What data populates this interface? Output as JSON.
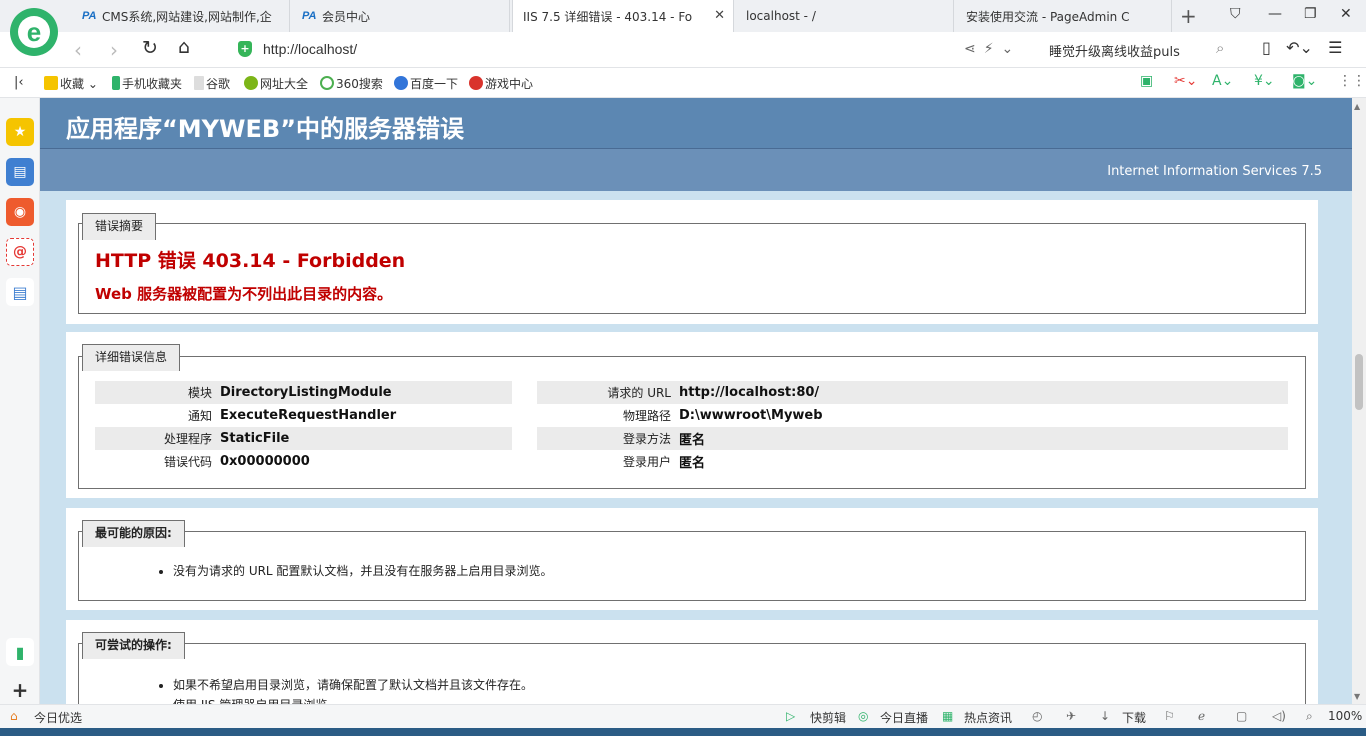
{
  "tabs": [
    {
      "fav": "PA",
      "title": "CMS系统,网站建设,网站制作,企",
      "active": false
    },
    {
      "fav": "PA",
      "title": "会员中心",
      "active": false
    },
    {
      "fav": "page",
      "title": "IIS 7.5 详细错误 - 403.14 - Fo",
      "active": true
    },
    {
      "fav": "page",
      "title": "localhost - /",
      "active": false
    },
    {
      "fav": "page",
      "title": "安装使用交流 - PageAdmin C",
      "active": false
    }
  ],
  "address": {
    "url": "http://localhost/",
    "search_text": "睡觉升级离线收益puls"
  },
  "bookmarks": [
    "收藏",
    "手机收藏夹",
    "谷歌",
    "网址大全",
    "360搜索",
    "百度一下",
    "游戏中心"
  ],
  "page": {
    "header_title": "应用程序“MYWEB”中的服务器错误",
    "server_name": "Internet Information Services 7.5",
    "summary": {
      "legend": "错误摘要",
      "error_title": "HTTP 错误 403.14 - Forbidden",
      "error_message": "Web 服务器被配置为不列出此目录的内容。"
    },
    "details": {
      "legend": "详细错误信息",
      "left": [
        {
          "k": "模块",
          "v": "DirectoryListingModule"
        },
        {
          "k": "通知",
          "v": "ExecuteRequestHandler"
        },
        {
          "k": "处理程序",
          "v": "StaticFile"
        },
        {
          "k": "错误代码",
          "v": "0x00000000"
        }
      ],
      "right": [
        {
          "k": "请求的 URL",
          "v": "http://localhost:80/"
        },
        {
          "k": "物理路径",
          "v": "D:\\wwwroot\\Myweb"
        },
        {
          "k": "登录方法",
          "v": "匿名"
        },
        {
          "k": "登录用户",
          "v": "匿名"
        }
      ]
    },
    "causes": {
      "legend": "最可能的原因:",
      "items": [
        "没有为请求的 URL 配置默认文档，并且没有在服务器上启用目录浏览。"
      ]
    },
    "actions": {
      "legend": "可尝试的操作:",
      "items": [
        "如果不希望启用目录浏览，请确保配置了默认文档并且该文件存在。",
        "使用 IIS 管理器启用目录浏览。"
      ]
    }
  },
  "status": {
    "left": "今日优选",
    "items": [
      "快剪辑",
      "今日直播",
      "热点资讯",
      "下载"
    ],
    "zoom": "100%"
  }
}
